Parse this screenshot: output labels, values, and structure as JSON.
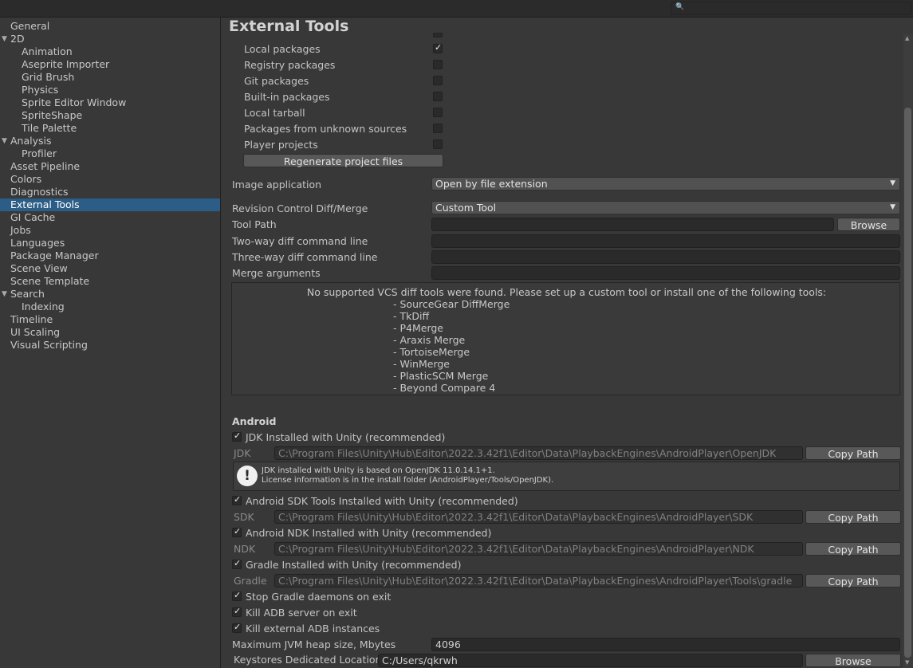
{
  "search": {
    "icon": "search-icon",
    "value": ""
  },
  "sidebar": {
    "items": [
      {
        "label": "General"
      },
      {
        "label": "2D"
      },
      {
        "label": "Animation"
      },
      {
        "label": "Aseprite Importer"
      },
      {
        "label": "Grid Brush"
      },
      {
        "label": "Physics"
      },
      {
        "label": "Sprite Editor Window"
      },
      {
        "label": "SpriteShape"
      },
      {
        "label": "Tile Palette"
      },
      {
        "label": "Analysis"
      },
      {
        "label": "Profiler"
      },
      {
        "label": "Asset Pipeline"
      },
      {
        "label": "Colors"
      },
      {
        "label": "Diagnostics"
      },
      {
        "label": "External Tools"
      },
      {
        "label": "GI Cache"
      },
      {
        "label": "Jobs"
      },
      {
        "label": "Languages"
      },
      {
        "label": "Package Manager"
      },
      {
        "label": "Scene View"
      },
      {
        "label": "Scene Template"
      },
      {
        "label": "Search"
      },
      {
        "label": "Indexing"
      },
      {
        "label": "Timeline"
      },
      {
        "label": "UI Scaling"
      },
      {
        "label": "Visual Scripting"
      }
    ],
    "selected": "External Tools"
  },
  "main": {
    "title": "External Tools",
    "packages": [
      {
        "label": "Local packages",
        "checked": true
      },
      {
        "label": "Registry packages",
        "checked": false
      },
      {
        "label": "Git packages",
        "checked": false
      },
      {
        "label": "Built-in packages",
        "checked": false
      },
      {
        "label": "Local tarball",
        "checked": false
      },
      {
        "label": "Packages from unknown sources",
        "checked": false
      },
      {
        "label": "Player projects",
        "checked": false
      }
    ],
    "regenerate_label": "Regenerate project files",
    "image_app": {
      "label": "Image application",
      "value": "Open by file extension"
    },
    "revision": {
      "label": "Revision Control Diff/Merge",
      "value": "Custom Tool"
    },
    "tool_path": {
      "label": "Tool Path",
      "value": "",
      "browse": "Browse"
    },
    "two_way": {
      "label": "Two-way diff command line",
      "value": ""
    },
    "three_way": {
      "label": "Three-way diff command line",
      "value": ""
    },
    "merge_args": {
      "label": "Merge arguments",
      "value": ""
    },
    "vcs": {
      "message": "No supported VCS diff tools were found. Please set up a custom tool or install one of the following tools:",
      "tools": [
        "- SourceGear DiffMerge",
        "- TkDiff",
        "- P4Merge",
        "- Araxis Merge",
        "- TortoiseMerge",
        "- WinMerge",
        "- PlasticSCM Merge",
        "- Beyond Compare 4"
      ]
    },
    "android": {
      "title": "Android",
      "jdk_check": {
        "label": "JDK Installed with Unity (recommended)",
        "checked": true
      },
      "jdk": {
        "label": "JDK",
        "path": "C:\\Program Files\\Unity\\Hub\\Editor\\2022.3.42f1\\Editor\\Data\\PlaybackEngines\\AndroidPlayer\\OpenJDK",
        "copy": "Copy Path"
      },
      "jdk_info_1": "JDK installed with Unity is based on OpenJDK 11.0.14.1+1.",
      "jdk_info_2": "License information is in the install folder (AndroidPlayer/Tools/OpenJDK).",
      "info_icon": "exclamation-icon",
      "sdk_check": {
        "label": "Android SDK Tools Installed with Unity (recommended)",
        "checked": true
      },
      "sdk": {
        "label": "SDK",
        "path": "C:\\Program Files\\Unity\\Hub\\Editor\\2022.3.42f1\\Editor\\Data\\PlaybackEngines\\AndroidPlayer\\SDK",
        "copy": "Copy Path"
      },
      "ndk_check": {
        "label": "Android NDK Installed with Unity (recommended)",
        "checked": true
      },
      "ndk": {
        "label": "NDK",
        "path": "C:\\Program Files\\Unity\\Hub\\Editor\\2022.3.42f1\\Editor\\Data\\PlaybackEngines\\AndroidPlayer\\NDK",
        "copy": "Copy Path"
      },
      "gradle_check": {
        "label": "Gradle Installed with Unity (recommended)",
        "checked": true
      },
      "gradle": {
        "label": "Gradle",
        "path": "C:\\Program Files\\Unity\\Hub\\Editor\\2022.3.42f1\\Editor\\Data\\PlaybackEngines\\AndroidPlayer\\Tools\\gradle",
        "copy": "Copy Path"
      },
      "stop_gradle": {
        "label": "Stop Gradle daemons on exit",
        "checked": true
      },
      "kill_adb": {
        "label": "Kill ADB server on exit",
        "checked": true
      },
      "kill_ext_adb": {
        "label": "Kill external ADB instances",
        "checked": true
      },
      "jvm_heap": {
        "label": "Maximum JVM heap size, Mbytes",
        "value": "4096"
      },
      "keystores": {
        "label": "Keystores Dedicated Location",
        "value": "C:/Users/qkrwh",
        "browse": "Browse"
      }
    }
  }
}
